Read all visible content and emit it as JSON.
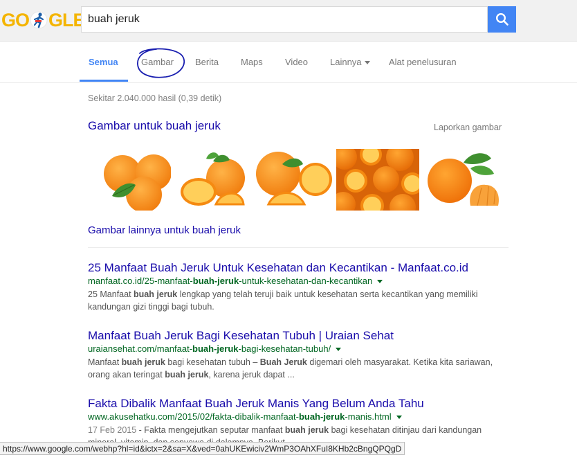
{
  "header": {
    "logo_left": "GO",
    "logo_right": "GLE",
    "search_value": "buah jeruk",
    "search_icon": "search-icon",
    "colors": {
      "logo": "#f4b400",
      "search_button": "#4285f4"
    }
  },
  "tabs": {
    "items": [
      {
        "label": "Semua",
        "active": true
      },
      {
        "label": "Gambar"
      },
      {
        "label": "Berita"
      },
      {
        "label": "Maps"
      },
      {
        "label": "Video"
      },
      {
        "label": "Lainnya"
      },
      {
        "label": "Alat penelusuran"
      }
    ]
  },
  "stats": "Sekitar 2.040.000 hasil (0,39 detik)",
  "images_section": {
    "heading": "Gambar untuk buah jeruk",
    "report": "Laporkan gambar",
    "more": "Gambar lainnya untuk buah jeruk"
  },
  "results": [
    {
      "title": "25 Manfaat Buah Jeruk Untuk Kesehatan dan Kecantikan - Manfaat.co.id",
      "url_pre": "manfaat.co.id/25-manfaat-",
      "url_bold": "buah-jeruk",
      "url_post": "-untuk-kesehatan-dan-kecantikan",
      "s1": "25 Manfaat ",
      "b1": "buah jeruk",
      "s2": " lengkap yang telah teruji baik untuk kesehatan serta kecantikan yang memiliki kandungan gizi tinggi bagi tubuh."
    },
    {
      "title": "Manfaat Buah Jeruk Bagi Kesehatan Tubuh | Uraian Sehat",
      "url_pre": "uraiansehat.com/manfaat-",
      "url_bold": "buah-jeruk",
      "url_post": "-bagi-kesehatan-tubuh/",
      "s1": "Manfaat ",
      "b1": "buah jeruk",
      "s2": " bagi kesehatan tubuh – ",
      "b2": "Buah Jeruk",
      "s3": " digemari oleh masyarakat. Ketika kita sariawan, orang akan teringat ",
      "b3": "buah jeruk",
      "s4": ", karena jeruk dapat ..."
    },
    {
      "title": "Fakta Dibalik Manfaat Buah Jeruk Manis Yang Belum Anda Tahu",
      "url_pre": "www.akusehatku.com/2015/02/fakta-dibalik-manfaat-",
      "url_bold": "buah-jeruk",
      "url_post": "-manis.html",
      "date": "17 Feb 2015",
      "s1": " - Fakta mengejutkan seputar manfaat ",
      "b1": "buah jeruk",
      "s2": " bagi kesehatan ditinjau dari kandungan mineral, vitamin, dan senyawa di dalamnya. Berikut ..."
    }
  ],
  "status_url": "https://www.google.com/webhp?hl=id&ictx=2&sa=X&ved=0ahUKEwiciv2WmP3OAhXFuI8KHb2cBngQPQgD"
}
